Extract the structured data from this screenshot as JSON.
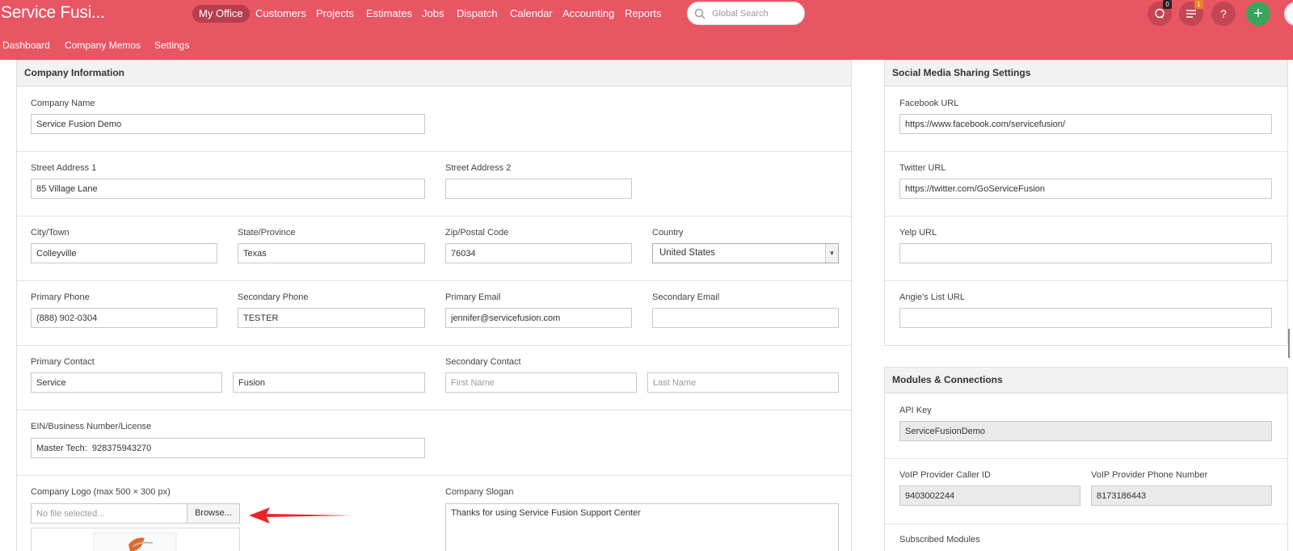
{
  "app": {
    "title": "Service Fusi..."
  },
  "nav": {
    "items": [
      "My Office",
      "Customers",
      "Projects",
      "Estimates",
      "Jobs",
      "Dispatch",
      "Calendar",
      "Accounting",
      "Reports"
    ],
    "active": "My Office",
    "search_placeholder": "Global Search",
    "chat_badge": "0",
    "tasks_badge": "1",
    "help_glyph": "?",
    "add_glyph": "+"
  },
  "subnav": {
    "items": [
      "Dashboard",
      "Company Memos",
      "Settings"
    ]
  },
  "company": {
    "header": "Company Information",
    "company_name": {
      "label": "Company Name",
      "value": "Service Fusion Demo"
    },
    "street1": {
      "label": "Street Address 1",
      "value": "85 Village Lane"
    },
    "street2": {
      "label": "Street Address 2",
      "value": ""
    },
    "city": {
      "label": "City/Town",
      "value": "Colleyville"
    },
    "state": {
      "label": "State/Province",
      "value": "Texas"
    },
    "zip": {
      "label": "Zip/Postal Code",
      "value": "76034"
    },
    "country": {
      "label": "Country",
      "value": "United States"
    },
    "primary_phone": {
      "label": "Primary Phone",
      "value": "(888) 902-0304"
    },
    "secondary_phone": {
      "label": "Secondary Phone",
      "value": "TESTER"
    },
    "primary_email": {
      "label": "Primary Email",
      "value": "jennifer@servicefusion.com"
    },
    "secondary_email": {
      "label": "Secondary Email",
      "value": ""
    },
    "primary_contact": {
      "label": "Primary Contact",
      "first": "Service",
      "last": "Fusion"
    },
    "secondary_contact": {
      "label": "Secondary Contact",
      "first_placeholder": "First Name",
      "last_placeholder": "Last Name"
    },
    "ein": {
      "label": "EIN/Business Number/License",
      "value": "Master Tech:  928375943270"
    },
    "logo": {
      "label": "Company Logo (max 500 × 300 px)",
      "file_placeholder": "No file selected...",
      "browse": "Browse..."
    },
    "slogan": {
      "label": "Company Slogan",
      "value": "Thanks for using Service Fusion Support Center"
    }
  },
  "social": {
    "header": "Social Media Sharing Settings",
    "facebook": {
      "label": "Facebook URL",
      "value": "https://www.facebook.com/servicefusion/"
    },
    "twitter": {
      "label": "Twitter URL",
      "value": "https://twitter.com/GoServiceFusion"
    },
    "yelp": {
      "label": "Yelp URL",
      "value": ""
    },
    "angies": {
      "label": "Angie's List URL",
      "value": ""
    }
  },
  "modules": {
    "header": "Modules & Connections",
    "api_key": {
      "label": "API Key",
      "value": "ServiceFusionDemo"
    },
    "voip_caller": {
      "label": "VoIP Provider Caller ID",
      "value": "9403002244"
    },
    "voip_phone": {
      "label": "VoIP Provider Phone Number",
      "value": "8173186443"
    },
    "subscribed_label": "Subscribed Modules"
  },
  "colors": {
    "brand": "#e85563",
    "active_nav": "#b83e4e",
    "annotation_arrow": "#e8262a"
  }
}
